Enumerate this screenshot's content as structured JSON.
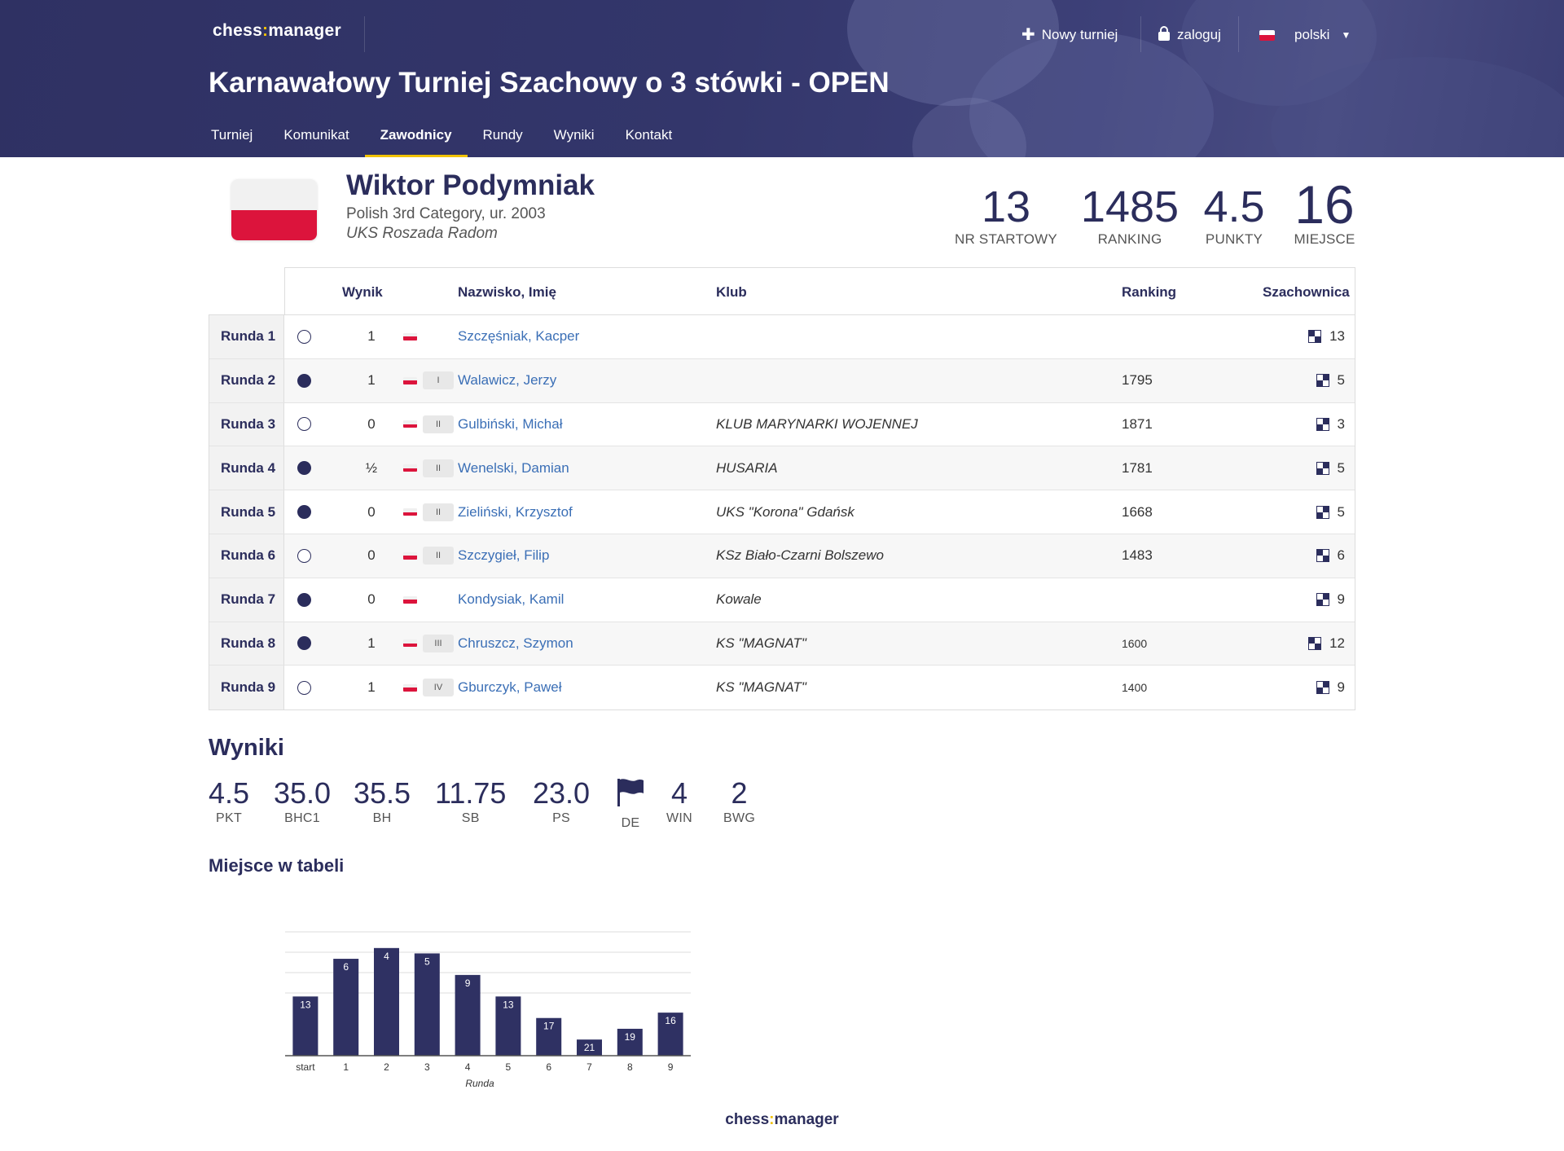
{
  "header": {
    "logo_left": "chess",
    "logo_colon": ":",
    "logo_right": "manager",
    "new_tournament": "Nowy turniej",
    "login": "zaloguj",
    "language": "polski",
    "title": "Karnawałowy Turniej Szachowy o 3 stówki - OPEN"
  },
  "tabs": [
    "Turniej",
    "Komunikat",
    "Zawodnicy",
    "Rundy",
    "Wyniki",
    "Kontakt"
  ],
  "active_tab": "Zawodnicy",
  "player": {
    "name": "Wiktor Podymniak",
    "category": "Polish 3rd Category, ur. 2003",
    "club": "UKS Roszada Radom",
    "stats": [
      {
        "value": "13",
        "label": "NR STARTOWY"
      },
      {
        "value": "1485",
        "label": "RANKING"
      },
      {
        "value": "4.5",
        "label": "PUNKTY"
      },
      {
        "value": "16",
        "label": "MIEJSCE"
      }
    ]
  },
  "table": {
    "headers": {
      "result": "Wynik",
      "name": "Nazwisko, Imię",
      "club": "Klub",
      "ranking": "Ranking",
      "board": "Szachownica"
    },
    "rows": [
      {
        "round": "Runda 1",
        "color": "white",
        "result": "1",
        "category": "",
        "opponent": "Szczęśniak, Kacper",
        "club": "",
        "ranking": "",
        "ranking_small": false,
        "board": "13",
        "board_icon": "tl-dark"
      },
      {
        "round": "Runda 2",
        "color": "black",
        "result": "1",
        "category": "I",
        "opponent": "Walawicz, Jerzy",
        "club": "",
        "ranking": "1795",
        "ranking_small": false,
        "board": "5",
        "board_icon": "br-dark"
      },
      {
        "round": "Runda 3",
        "color": "white",
        "result": "0",
        "category": "II",
        "opponent": "Gulbiński, Michał",
        "club": "KLUB MARYNARKI WOJENNEJ",
        "ranking": "1871",
        "ranking_small": false,
        "board": "3",
        "board_icon": "br-dark"
      },
      {
        "round": "Runda 4",
        "color": "black",
        "result": "½",
        "category": "II",
        "opponent": "Wenelski, Damian",
        "club": "HUSARIA",
        "ranking": "1781",
        "ranking_small": false,
        "board": "5",
        "board_icon": "br-dark"
      },
      {
        "round": "Runda 5",
        "color": "black",
        "result": "0",
        "category": "II",
        "opponent": "Zieliński, Krzysztof",
        "club": "UKS \"Korona\" Gdańsk",
        "ranking": "1668",
        "ranking_small": false,
        "board": "5",
        "board_icon": "br-dark"
      },
      {
        "round": "Runda 6",
        "color": "white",
        "result": "0",
        "category": "II",
        "opponent": "Szczygieł, Filip",
        "club": "KSz Biało-Czarni Bolszewo",
        "ranking": "1483",
        "ranking_small": false,
        "board": "6",
        "board_icon": "tl-dark"
      },
      {
        "round": "Runda 7",
        "color": "black",
        "result": "0",
        "category": "",
        "opponent": "Kondysiak, Kamil",
        "club": "Kowale",
        "ranking": "",
        "ranking_small": false,
        "board": "9",
        "board_icon": "br-dark"
      },
      {
        "round": "Runda 8",
        "color": "black",
        "result": "1",
        "category": "III",
        "opponent": "Chruszcz, Szymon",
        "club": "KS \"MAGNAT\"",
        "ranking": "1600",
        "ranking_small": true,
        "board": "12",
        "board_icon": "tl-dark"
      },
      {
        "round": "Runda 9",
        "color": "white",
        "result": "1",
        "category": "IV",
        "opponent": "Gburczyk, Paweł",
        "club": "KS \"MAGNAT\"",
        "ranking": "1400",
        "ranking_small": true,
        "board": "9",
        "board_icon": "br-dark"
      }
    ]
  },
  "results": {
    "heading": "Wyniki",
    "items": [
      {
        "value": "4.5",
        "label": "PKT"
      },
      {
        "value": "35.0",
        "label": "BHC1"
      },
      {
        "value": "35.5",
        "label": "BH"
      },
      {
        "value": "11.75",
        "label": "SB"
      },
      {
        "value": "23.0",
        "label": "PS"
      },
      {
        "value": "",
        "label": "DE",
        "icon": "flag-icon"
      },
      {
        "value": "4",
        "label": "WIN"
      },
      {
        "value": "2",
        "label": "BWG"
      }
    ]
  },
  "standing_heading": "Miejsce w tabeli",
  "chart_data": {
    "type": "bar",
    "categories": [
      "start",
      "1",
      "2",
      "3",
      "4",
      "5",
      "6",
      "7",
      "8",
      "9"
    ],
    "values": [
      13,
      6,
      4,
      5,
      9,
      13,
      17,
      21,
      19,
      16
    ],
    "xlabel": "Runda",
    "ylabel": "",
    "inverted_axis": true,
    "ylim": [
      1,
      24
    ],
    "bar_color": "#2f3163",
    "grid": true
  },
  "footer": {
    "logo_left": "chess",
    "logo_colon": ":",
    "logo_right": "manager"
  }
}
